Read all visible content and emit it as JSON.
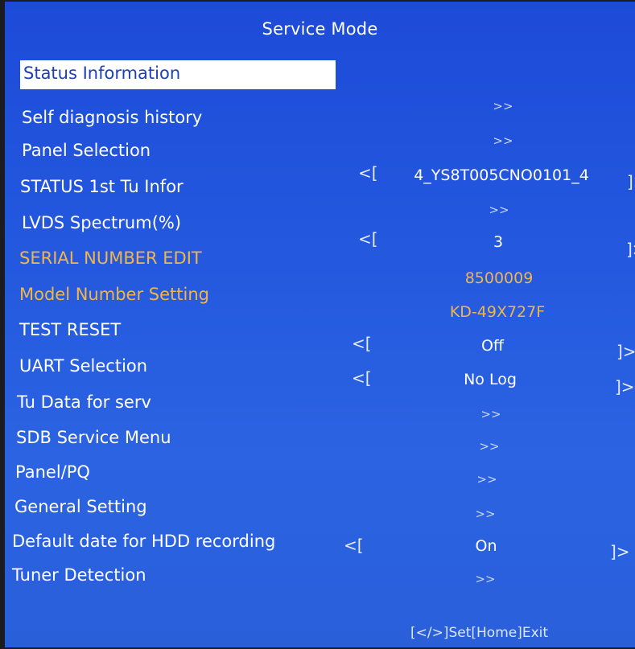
{
  "title": "Service Mode",
  "menu": [
    {
      "label": "Status Information",
      "value_type": "none"
    },
    {
      "label": "Self diagnosis history",
      "value_type": "arrow",
      "value": ">>"
    },
    {
      "label": "Panel Selection",
      "value_type": "arrow",
      "value": ">>"
    },
    {
      "label": "STATUS 1st Tu Infor",
      "value_type": "select",
      "value": "4_YS8T005CNO0101_4",
      "left": "<[",
      "right": "]>"
    },
    {
      "label": "LVDS Spectrum(%)",
      "value_type": "arrow",
      "value": ">>"
    },
    {
      "label": "SERIAL NUMBER EDIT",
      "value_type": "select",
      "value": "3",
      "left": "<[",
      "right": "]>"
    },
    {
      "label": "Model Number Setting",
      "value_type": "text",
      "value": "8500009"
    },
    {
      "label": "TEST RESET",
      "value_type": "text",
      "value": "KD-49X727F"
    },
    {
      "label": "UART Selection",
      "value_type": "select",
      "value": "Off",
      "left": "<[",
      "right": "]>"
    },
    {
      "label": "Tu Data for serv",
      "value_type": "select",
      "value": "No Log",
      "left": "<[",
      "right": "]>"
    },
    {
      "label": "SDB Service Menu",
      "value_type": "arrow",
      "value": ">>"
    },
    {
      "label": "Panel/PQ",
      "value_type": "arrow",
      "value": ">>"
    },
    {
      "label": "General Setting",
      "value_type": "arrow",
      "value": ">>"
    },
    {
      "label": "Default date for HDD recording",
      "value_type": "arrow",
      "value": ">>"
    },
    {
      "label": "Tuner Detection",
      "value_type": "select",
      "value": "On",
      "left": "<[",
      "right": "]>"
    },
    {
      "label": "",
      "value_type": "arrow",
      "value": ">>"
    }
  ],
  "footer": "[</>]Set[Home]Exit",
  "colors": {
    "background": "#2357de",
    "highlight": "#ffffff",
    "warning_text": "#f0b64a"
  }
}
